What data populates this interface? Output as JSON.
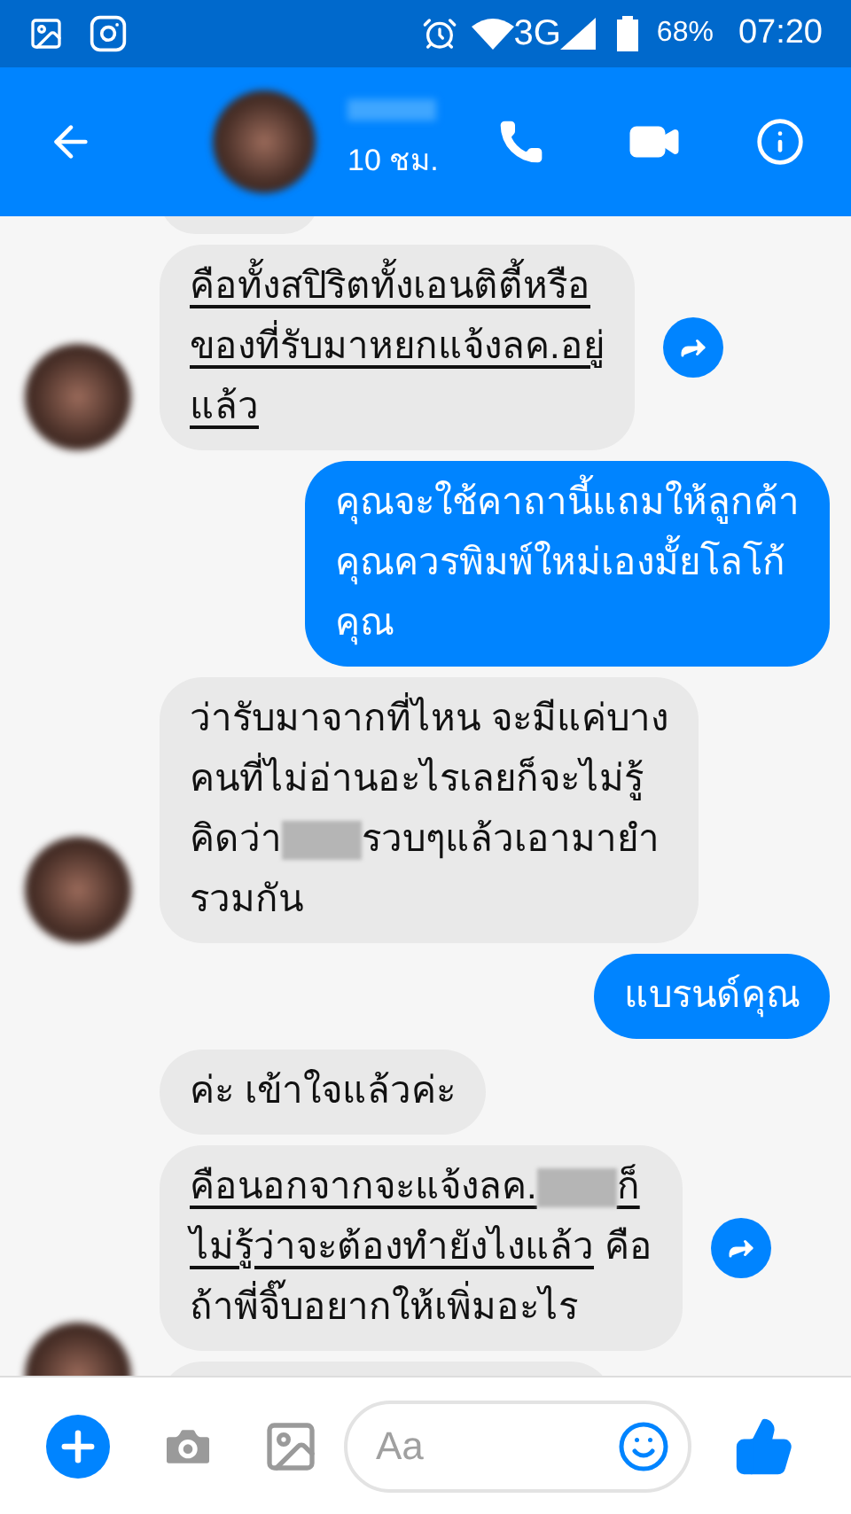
{
  "status_bar": {
    "battery": "68%",
    "network": "3G",
    "time": "07:20"
  },
  "header": {
    "subtitle": "10 ชม."
  },
  "messages": [
    {
      "kind": "incoming",
      "avatar": true,
      "share": true,
      "segments": [
        {
          "kind": "text",
          "text": "คือทั้งสปิริตทั้งเอนติตี้หรือ\nของที่รับมาหยกแจ้งลค.อยู่\nแล้ว",
          "underline": true
        }
      ]
    },
    {
      "kind": "outgoing",
      "segments": [
        {
          "kind": "text",
          "text": "คุณจะใช้คาถานี้แถมให้ลูกค้า\nคุณควรพิมพ์ใหม่เองมั้ยโลโก้\nคุณ",
          "underline": false
        }
      ]
    },
    {
      "kind": "incoming",
      "avatar": true,
      "share": false,
      "segments": [
        {
          "kind": "text",
          "text": "ว่ารับมาจากที่ไหน จะมีแค่บาง\nคนที่ไม่อ่านอะไรเลยก็จะไม่รู้\nคิดว่า",
          "underline": false
        },
        {
          "kind": "redacted"
        },
        {
          "kind": "text",
          "text": "รวบๆแล้วเอามายำ\nรวมกัน",
          "underline": false
        }
      ]
    },
    {
      "kind": "outgoing",
      "segments": [
        {
          "kind": "text",
          "text": "แบรนด์คุณ",
          "underline": false
        }
      ]
    },
    {
      "kind": "incoming",
      "avatar": false,
      "share": false,
      "segments": [
        {
          "kind": "text",
          "text": "ค่ะ เข้าใจแล้วค่ะ",
          "underline": false
        }
      ]
    },
    {
      "kind": "incoming",
      "avatar": false,
      "share": true,
      "segments": [
        {
          "kind": "text",
          "text": "คือนอกจากจะแจ้งลค.",
          "underline": true
        },
        {
          "kind": "redacted"
        },
        {
          "kind": "text",
          "text": "ก็\nไม่รู้ว่าจะต้องทำยังไงแล้ว",
          "underline": true
        },
        {
          "kind": "text",
          "text": " คือ\nถ้าพี่จิ๊บอยากให้เพิ่มอะไร",
          "underline": false
        }
      ]
    }
  ],
  "composer": {
    "placeholder": "Aa"
  }
}
